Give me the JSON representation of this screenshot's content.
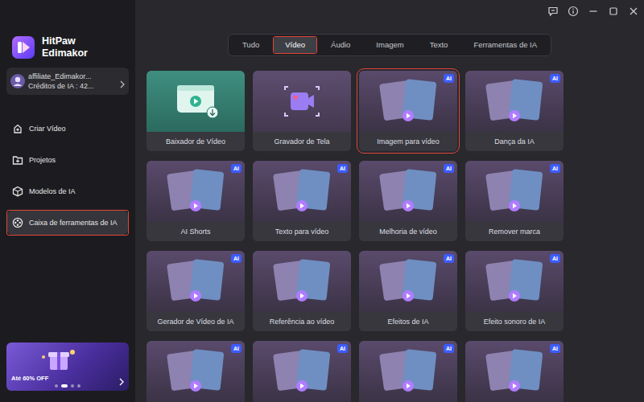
{
  "app": {
    "brand": "HitPaw",
    "product": "Edimakor"
  },
  "user": {
    "name": "affiliate_Edimakor...",
    "credits": "Créditos de IA : 42..."
  },
  "sidebar": {
    "items": [
      {
        "label": "Criar Vídeo",
        "selected": false,
        "highlighted": false
      },
      {
        "label": "Projetos",
        "selected": false,
        "highlighted": false
      },
      {
        "label": "Modelos de IA",
        "selected": false,
        "highlighted": false
      },
      {
        "label": "Caixa de ferramentas de IA",
        "selected": true,
        "highlighted": true
      }
    ]
  },
  "promo": {
    "text": "Até 60% OFF",
    "dots": [
      {
        "selected": false
      },
      {
        "selected": true
      },
      {
        "selected": false
      },
      {
        "selected": false
      }
    ]
  },
  "tabs": [
    {
      "label": "Tudo",
      "selected": false,
      "highlighted": false
    },
    {
      "label": "Vídeo",
      "selected": true,
      "highlighted": true
    },
    {
      "label": "Áudio",
      "selected": false,
      "highlighted": false
    },
    {
      "label": "Imagem",
      "selected": false,
      "highlighted": false
    },
    {
      "label": "Texto",
      "selected": false,
      "highlighted": false
    },
    {
      "label": "Ferramentas de IA",
      "selected": false,
      "highlighted": false
    }
  ],
  "cards": [
    {
      "label": "Baixador de Vídeo",
      "kind": "download",
      "highlighted": false
    },
    {
      "label": "Gravador de Tela",
      "kind": "record",
      "highlighted": false
    },
    {
      "label": "Imagem para vídeo",
      "kind": "media",
      "badge": "AI",
      "highlighted": true
    },
    {
      "label": "Dança da IA",
      "kind": "media",
      "badge": "AI",
      "highlighted": false
    },
    {
      "label": "AI Shorts",
      "kind": "media",
      "badge": "AI",
      "highlighted": false
    },
    {
      "label": "Texto para vídeo",
      "kind": "media",
      "badge": "AI",
      "highlighted": false
    },
    {
      "label": "Melhoria de vídeo",
      "kind": "media",
      "badge": "AI",
      "highlighted": false
    },
    {
      "label": "Remover marca",
      "kind": "media",
      "badge": "AI",
      "highlighted": false
    },
    {
      "label": "Gerador de Vídeo de IA",
      "kind": "media",
      "badge": "AI",
      "highlighted": false
    },
    {
      "label": "Referência ao vídeo",
      "kind": "media",
      "highlighted": false
    },
    {
      "label": "Efeitos de IA",
      "kind": "media",
      "badge": "AI",
      "highlighted": false
    },
    {
      "label": "Efeito sonoro de IA",
      "kind": "media",
      "badge": "AI",
      "highlighted": false
    },
    {
      "kind": "media",
      "badge": "AI",
      "highlighted": false
    },
    {
      "kind": "media",
      "badge": "AI",
      "highlighted": false
    },
    {
      "kind": "media",
      "badge": "AI",
      "highlighted": false
    },
    {
      "kind": "media",
      "badge": "AI",
      "highlighted": false
    }
  ]
}
